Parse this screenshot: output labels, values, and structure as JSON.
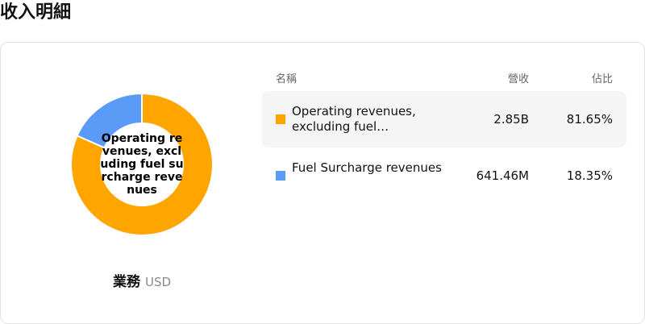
{
  "page": {
    "title": "收入明細"
  },
  "chart_data": {
    "type": "pie",
    "donut": true,
    "center_label": "Operating revenues, excluding fuel surcharge revenues",
    "caption": {
      "segment": "業務",
      "currency": "USD"
    },
    "slices": [
      {
        "name": "Operating revenues, excluding fuel surcharge revenues",
        "display_name": "Operating revenues, excluding fuel…",
        "revenue": "2.85B",
        "percent": 81.65,
        "percent_label": "81.65%",
        "color": "#FFA500"
      },
      {
        "name": "Fuel Surcharge revenues",
        "display_name": "Fuel Surcharge revenues",
        "revenue": "641.46M",
        "percent": 18.35,
        "percent_label": "18.35%",
        "color": "#5B9BF8"
      }
    ]
  },
  "table": {
    "headers": {
      "name": "名稱",
      "revenue": "營收",
      "percent": "佔比"
    }
  }
}
